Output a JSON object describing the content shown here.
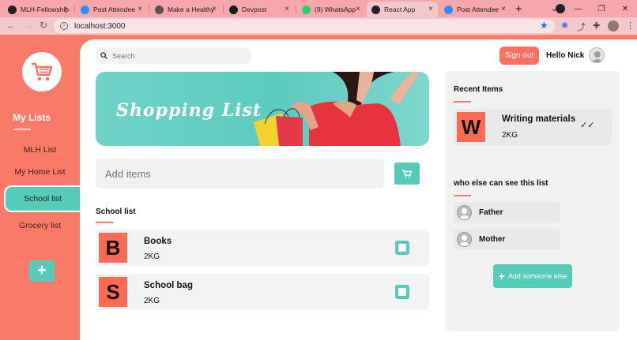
{
  "browser": {
    "tabs": [
      {
        "title": "MLH-Fellowship",
        "fav": "#222222"
      },
      {
        "title": "Post Attendee",
        "fav": "#2d8cff"
      },
      {
        "title": "Make a Healthy",
        "fav": "#555555"
      },
      {
        "title": "Devpost",
        "fav": "#1b1b1b"
      },
      {
        "title": "(9) WhatsApp",
        "fav": "#25d366"
      },
      {
        "title": "React App",
        "fav": "#20232a"
      },
      {
        "title": "Post Attendee",
        "fav": "#2d8cff"
      }
    ],
    "active_tab_index": 5,
    "url": "localhost:3000"
  },
  "sidebar": {
    "heading": "My Lists",
    "items": [
      {
        "label": "MLH List"
      },
      {
        "label": "My Home List"
      },
      {
        "label": "School list",
        "active": true
      },
      {
        "label": "Grocery list"
      }
    ],
    "add_label": "+"
  },
  "header": {
    "search_placeholder": "Search",
    "signout_label": "Sign out",
    "greeting": "Hello Nick"
  },
  "banner": {
    "title": "Shopping List"
  },
  "add_items": {
    "placeholder": "Add items"
  },
  "list": {
    "title": "School list",
    "items": [
      {
        "letter": "B",
        "name": "Books",
        "qty": "2KG"
      },
      {
        "letter": "S",
        "name": "School bag",
        "qty": "2KG"
      }
    ]
  },
  "recent": {
    "title": "Recent Items",
    "item": {
      "letter": "W",
      "name": "Writing materials",
      "qty": "2KG"
    }
  },
  "sharing": {
    "title": "who else can see this list",
    "people": [
      {
        "name": "Father"
      },
      {
        "name": "Mother"
      }
    ],
    "add_label": "Add someone else"
  },
  "colors": {
    "accent": "#fa7a6a",
    "teal": "#56cbb8"
  }
}
